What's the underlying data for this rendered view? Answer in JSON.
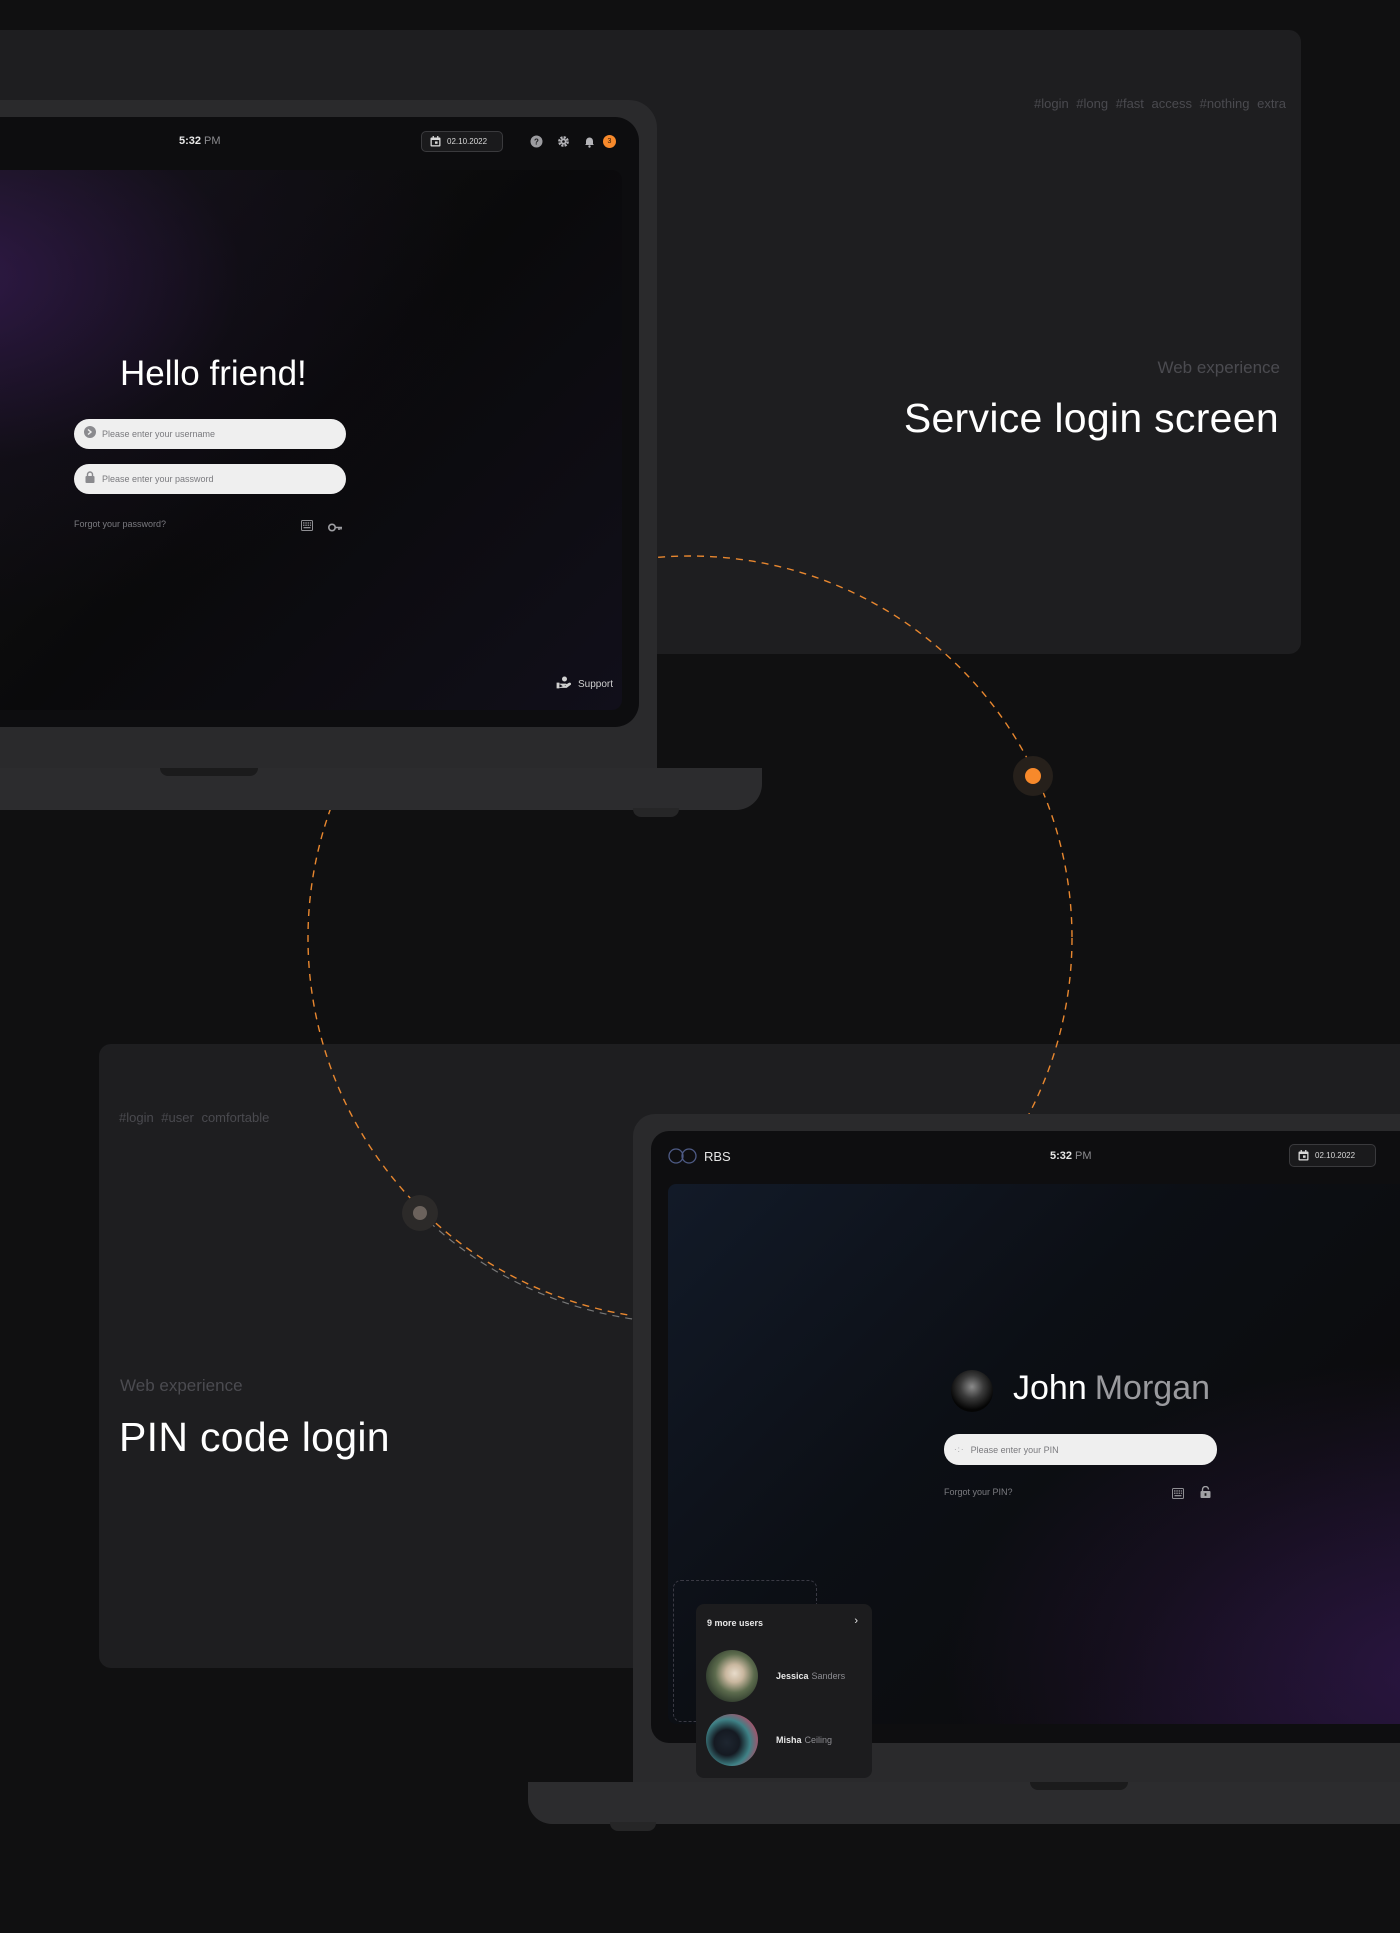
{
  "top_section": {
    "tags": "#login  #long  #fast access  #nothing extra",
    "kicker": "Web experience",
    "title": "Service login screen"
  },
  "bottom_section": {
    "tags": "#login  #user  comfortable",
    "kicker": "Web experience",
    "title": "PIN code login"
  },
  "laptop1": {
    "time": "5:32",
    "ampm": "PM",
    "date": "02.10.2022",
    "notification_count": "3",
    "greeting": "Hello friend!",
    "username_placeholder": "Please enter your username",
    "password_placeholder": "Please enter your password",
    "forgot": "Forgot your password?",
    "support": "Support",
    "icons": [
      "calendar-icon",
      "help-icon",
      "gear-icon",
      "bell-icon",
      "user-arrow-icon",
      "lock-icon",
      "keyboard-icon",
      "key-icon",
      "support-icon"
    ]
  },
  "laptop2": {
    "brand": "RBS",
    "time": "5:32",
    "ampm": "PM",
    "date": "02.10.2022",
    "user_first": "John",
    "user_last": "Morgan",
    "pin_placeholder": "Please enter your PIN",
    "forgot": "Forgot your PIN?",
    "more_users": "9 more users",
    "users": [
      {
        "first": "Jessica",
        "last": "Sanders"
      },
      {
        "first": "Misha",
        "last": "Ceiling"
      }
    ]
  },
  "colors": {
    "accent": "#f7892b",
    "panel": "#1e1e20",
    "background": "#101011"
  }
}
